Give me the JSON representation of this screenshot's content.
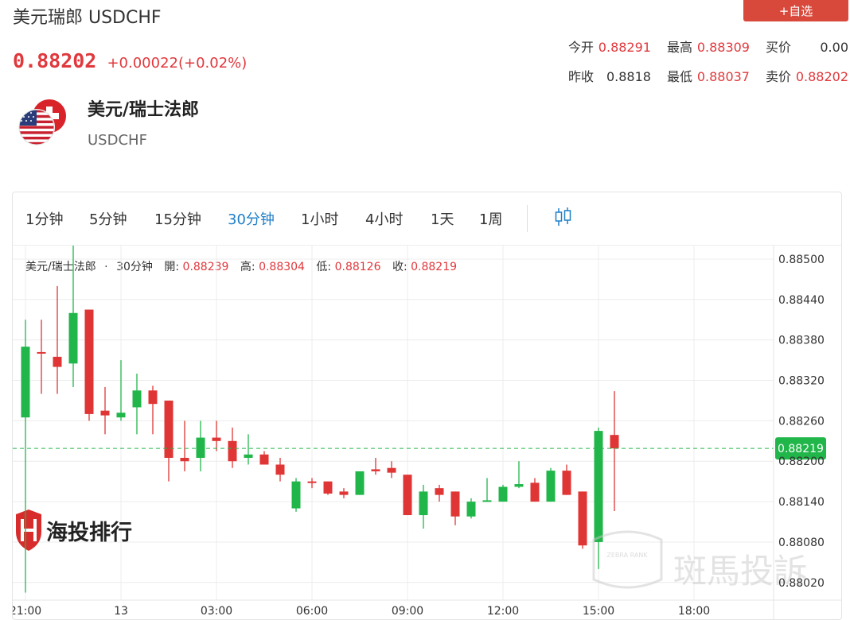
{
  "header": {
    "title": "美元瑞郎 USDCHF",
    "watch_label": "+自选",
    "price": "0.88202",
    "change": "+0.00022(+0.02%)",
    "stats_row1": [
      {
        "label": "今开",
        "value": "0.88291",
        "color": "#e0383c"
      },
      {
        "label": "最高",
        "value": "0.88309",
        "color": "#e0383c"
      },
      {
        "label": "买价",
        "value": "0.00",
        "color": "#333333"
      }
    ],
    "stats_row2": [
      {
        "label": "昨收",
        "value": "0.8818",
        "color": "#333333"
      },
      {
        "label": "最低",
        "value": "0.88037",
        "color": "#e0383c"
      },
      {
        "label": "卖价",
        "value": "0.88202",
        "color": "#e0383c"
      }
    ]
  },
  "pair": {
    "name_cn": "美元/瑞士法郎",
    "name_en": "USDCHF"
  },
  "toolbar": {
    "timeframes": [
      "1分钟",
      "5分钟",
      "15分钟",
      "30分钟",
      "1小时",
      "4小时",
      "1天",
      "1周"
    ],
    "active": "30分钟"
  },
  "info": {
    "symbol": "美元/瑞士法郎",
    "sep": "·",
    "period": "30分钟",
    "open_label": "開:",
    "open": "0.88239",
    "high_label": "高:",
    "high": "0.88304",
    "low_label": "低:",
    "low": "0.88126",
    "close_label": "收:",
    "close": "0.88219"
  },
  "watermarks": {
    "left": "海投排行",
    "right": "斑馬投訴",
    "shield": "ZEBRA RANK"
  },
  "chart_data": {
    "type": "candlestick",
    "y_ticks": [
      "0.88500",
      "0.88440",
      "0.88380",
      "0.88320",
      "0.88260",
      "0.88200",
      "0.88140",
      "0.88080",
      "0.88020"
    ],
    "ylim": [
      0.87995,
      0.8852
    ],
    "x_ticks": [
      "21:00",
      "13",
      "03:00",
      "06:00",
      "09:00",
      "12:00",
      "15:00",
      "18:00"
    ],
    "current_price": "0.88219",
    "up_color": "#21b64a",
    "down_color": "#e03535",
    "candles": [
      {
        "o": 0.88265,
        "h": 0.8841,
        "l": 0.88005,
        "c": 0.8837
      },
      {
        "o": 0.88362,
        "h": 0.8841,
        "l": 0.883,
        "c": 0.8836
      },
      {
        "o": 0.88355,
        "h": 0.8846,
        "l": 0.883,
        "c": 0.8834
      },
      {
        "o": 0.88345,
        "h": 0.8852,
        "l": 0.8831,
        "c": 0.8842
      },
      {
        "o": 0.88425,
        "h": 0.88425,
        "l": 0.8826,
        "c": 0.8827
      },
      {
        "o": 0.88275,
        "h": 0.8831,
        "l": 0.8824,
        "c": 0.88268
      },
      {
        "o": 0.88265,
        "h": 0.8835,
        "l": 0.8826,
        "c": 0.88272
      },
      {
        "o": 0.8828,
        "h": 0.8833,
        "l": 0.8824,
        "c": 0.88305
      },
      {
        "o": 0.88305,
        "h": 0.88312,
        "l": 0.8824,
        "c": 0.88285
      },
      {
        "o": 0.8829,
        "h": 0.8829,
        "l": 0.8817,
        "c": 0.88205
      },
      {
        "o": 0.88205,
        "h": 0.8826,
        "l": 0.88185,
        "c": 0.882
      },
      {
        "o": 0.88205,
        "h": 0.8826,
        "l": 0.88185,
        "c": 0.88235
      },
      {
        "o": 0.88235,
        "h": 0.8826,
        "l": 0.88215,
        "c": 0.8823
      },
      {
        "o": 0.8823,
        "h": 0.8825,
        "l": 0.8819,
        "c": 0.882
      },
      {
        "o": 0.88205,
        "h": 0.8824,
        "l": 0.88195,
        "c": 0.8821
      },
      {
        "o": 0.8821,
        "h": 0.88215,
        "l": 0.88195,
        "c": 0.88195
      },
      {
        "o": 0.88195,
        "h": 0.88205,
        "l": 0.8817,
        "c": 0.8818
      },
      {
        "o": 0.8813,
        "h": 0.88175,
        "l": 0.88125,
        "c": 0.8817
      },
      {
        "o": 0.8817,
        "h": 0.88175,
        "l": 0.8816,
        "c": 0.88168
      },
      {
        "o": 0.8817,
        "h": 0.8817,
        "l": 0.8815,
        "c": 0.88152
      },
      {
        "o": 0.88155,
        "h": 0.8816,
        "l": 0.88145,
        "c": 0.8815
      },
      {
        "o": 0.8815,
        "h": 0.88185,
        "l": 0.8815,
        "c": 0.88185
      },
      {
        "o": 0.88188,
        "h": 0.88205,
        "l": 0.8818,
        "c": 0.88185
      },
      {
        "o": 0.8819,
        "h": 0.882,
        "l": 0.88175,
        "c": 0.88183
      },
      {
        "o": 0.8818,
        "h": 0.8818,
        "l": 0.8812,
        "c": 0.8812
      },
      {
        "o": 0.8812,
        "h": 0.88165,
        "l": 0.881,
        "c": 0.88155
      },
      {
        "o": 0.8816,
        "h": 0.88165,
        "l": 0.8814,
        "c": 0.8815
      },
      {
        "o": 0.88155,
        "h": 0.88155,
        "l": 0.88105,
        "c": 0.88118
      },
      {
        "o": 0.88118,
        "h": 0.88145,
        "l": 0.88115,
        "c": 0.8814
      },
      {
        "o": 0.8814,
        "h": 0.88175,
        "l": 0.8814,
        "c": 0.88142
      },
      {
        "o": 0.8814,
        "h": 0.88165,
        "l": 0.8814,
        "c": 0.88162
      },
      {
        "o": 0.88162,
        "h": 0.882,
        "l": 0.8816,
        "c": 0.88166
      },
      {
        "o": 0.88168,
        "h": 0.88175,
        "l": 0.8814,
        "c": 0.8814
      },
      {
        "o": 0.8814,
        "h": 0.8819,
        "l": 0.8814,
        "c": 0.88186
      },
      {
        "o": 0.88186,
        "h": 0.88195,
        "l": 0.8815,
        "c": 0.8815
      },
      {
        "o": 0.88155,
        "h": 0.88155,
        "l": 0.8807,
        "c": 0.88075
      },
      {
        "o": 0.8808,
        "h": 0.8825,
        "l": 0.8804,
        "c": 0.88245
      },
      {
        "o": 0.88239,
        "h": 0.88304,
        "l": 0.88126,
        "c": 0.88219
      }
    ]
  }
}
